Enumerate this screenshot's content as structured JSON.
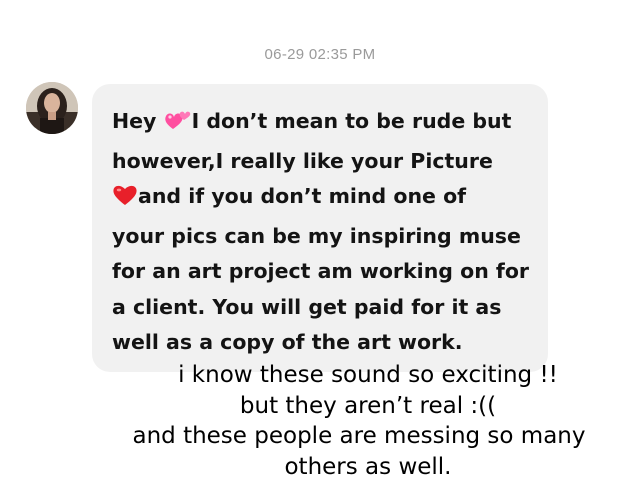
{
  "chat": {
    "timestamp": "06-29 02:35 PM",
    "avatar_icon": "profile-photo",
    "message": {
      "lines": [
        {
          "pre": "Hey ",
          "emoji": "two-hearts",
          "post": "I don’t mean to be rude but"
        },
        {
          "pre": "however,I really like your Picture",
          "emoji": "",
          "post": ""
        },
        {
          "pre": "",
          "emoji": "red-heart",
          "post": "and if you don’t mind one of"
        },
        {
          "pre": "your pics can be my inspiring muse",
          "emoji": "",
          "post": ""
        },
        {
          "pre": "for an art project am working on for",
          "emoji": "",
          "post": ""
        },
        {
          "pre": "a client.  You will get paid for it as",
          "emoji": "",
          "post": ""
        },
        {
          "pre": "well as a copy of the art work.",
          "emoji": "",
          "post": ""
        }
      ]
    }
  },
  "overlay_text": {
    "line1": "i know these sound so exciting !!",
    "line2": "but they aren’t real :((",
    "line3": "and these people are messing so many",
    "line4": "others as well."
  },
  "colors": {
    "bubble": "#f1f1f1",
    "timestamp": "#9a9a9a",
    "heart": "#e8202a",
    "pink_heart": "#ff5fa8"
  }
}
